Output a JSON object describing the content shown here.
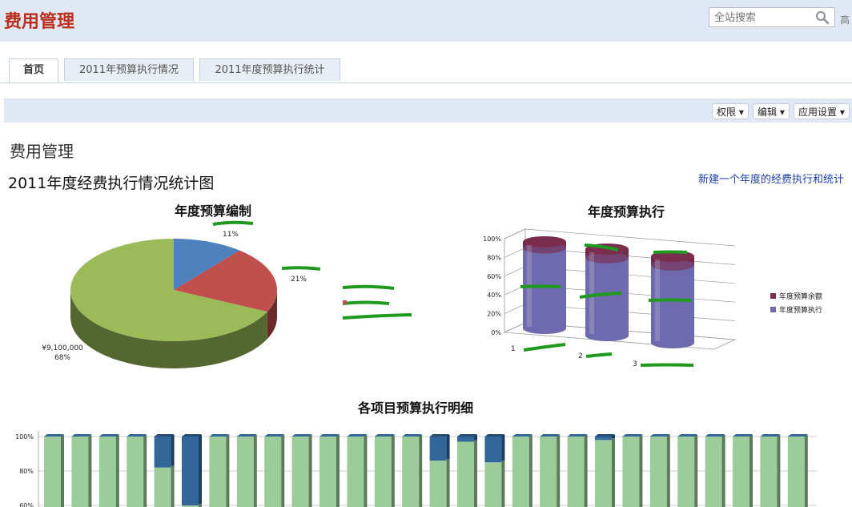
{
  "header": {
    "app_title": "费用管理",
    "search_placeholder": "全站搜索",
    "top_right_text": "高"
  },
  "tabs": [
    {
      "label": "首页",
      "active": true
    },
    {
      "label": "2011年预算执行情况",
      "active": false
    },
    {
      "label": "2011年度预算执行统计",
      "active": false
    }
  ],
  "toolbar": {
    "permissions": "权限 ▾",
    "edit": "编辑 ▾",
    "app_settings": "应用设置 ▾"
  },
  "page": {
    "section_title": "费用管理",
    "chart_heading": "2011年度经费执行情况统计图",
    "new_link": "新建一个年度的经费执行和统计"
  },
  "chart_data": [
    {
      "type": "pie",
      "title": "年度预算编制",
      "slices": [
        {
          "label": "¥9,100,000",
          "percent_label": "68%",
          "value": 68,
          "color": "#9bbb59"
        },
        {
          "label": "",
          "percent_label": "11%",
          "value": 11,
          "color": "#4f81bd"
        },
        {
          "label": "",
          "percent_label": "21%",
          "value": 21,
          "color": "#c0504d"
        }
      ]
    },
    {
      "type": "bar",
      "title": "年度预算执行",
      "y_ticks": [
        "0%",
        "20%",
        "40%",
        "60%",
        "80%",
        "100%"
      ],
      "ylim": [
        0,
        100
      ],
      "categories": [
        "1",
        "2",
        "3"
      ],
      "series": [
        {
          "name": "年度预算执行",
          "values": [
            93,
            90,
            90
          ],
          "color": "#6e6aad"
        },
        {
          "name": "年度预算余额",
          "values": [
            7,
            10,
            10
          ],
          "color": "#7b2d4e"
        }
      ],
      "legend_position": "right"
    },
    {
      "type": "bar",
      "title": "各项目预算执行明细",
      "y_ticks": [
        "100%",
        "80%",
        "60%"
      ],
      "ylim": [
        60,
        100
      ],
      "series": [
        {
          "name": "",
          "values": [
            100,
            100,
            100,
            100,
            82,
            60,
            100,
            100,
            100,
            100,
            100,
            100,
            100,
            100,
            86,
            97,
            85,
            100,
            100,
            100,
            98,
            100,
            100,
            100,
            100,
            100,
            100,
            100
          ],
          "color": "#9dcc9b"
        },
        {
          "name": "",
          "values": [
            0,
            0,
            0,
            0,
            18,
            40,
            0,
            0,
            0,
            0,
            0,
            0,
            0,
            0,
            14,
            3,
            15,
            0,
            0,
            0,
            2,
            0,
            0,
            0,
            0,
            0,
            0,
            0
          ],
          "color": "#336699"
        }
      ]
    }
  ],
  "colors": {
    "brand": "#b8311e",
    "header_bg": "#dfe8f3",
    "link": "#1c3fa8"
  }
}
